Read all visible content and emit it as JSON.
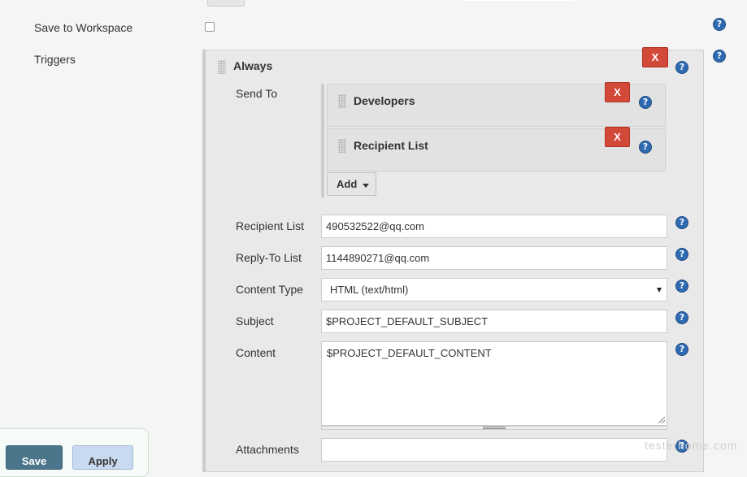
{
  "form": {
    "save_to_workspace_label": "Save to Workspace",
    "save_to_workspace_checked": false,
    "triggers_label": "Triggers"
  },
  "trigger": {
    "title": "Always",
    "delete_label": "X",
    "send_to_label": "Send To",
    "recipients": [
      {
        "name": "Developers",
        "delete_label": "X"
      },
      {
        "name": "Recipient List",
        "delete_label": "X"
      }
    ],
    "add_label": "Add",
    "fields": {
      "recipient_list": {
        "label": "Recipient List",
        "value": "490532522@qq.com"
      },
      "reply_to_list": {
        "label": "Reply-To List",
        "value": "1144890271@qq.com"
      },
      "content_type": {
        "label": "Content Type",
        "value": "HTML (text/html)"
      },
      "subject": {
        "label": "Subject",
        "value": "$PROJECT_DEFAULT_SUBJECT"
      },
      "content": {
        "label": "Content",
        "value": "$PROJECT_DEFAULT_CONTENT"
      },
      "attachments": {
        "label": "Attachments",
        "value": ""
      }
    }
  },
  "footer": {
    "save_label": "Save",
    "apply_label": "Apply"
  },
  "help_glyph": "?",
  "watermark": "testerhome.com",
  "colors": {
    "help": "#2e6ab1",
    "delete": "#d24939",
    "save": "#4b758b",
    "apply": "#c9d9ef"
  }
}
